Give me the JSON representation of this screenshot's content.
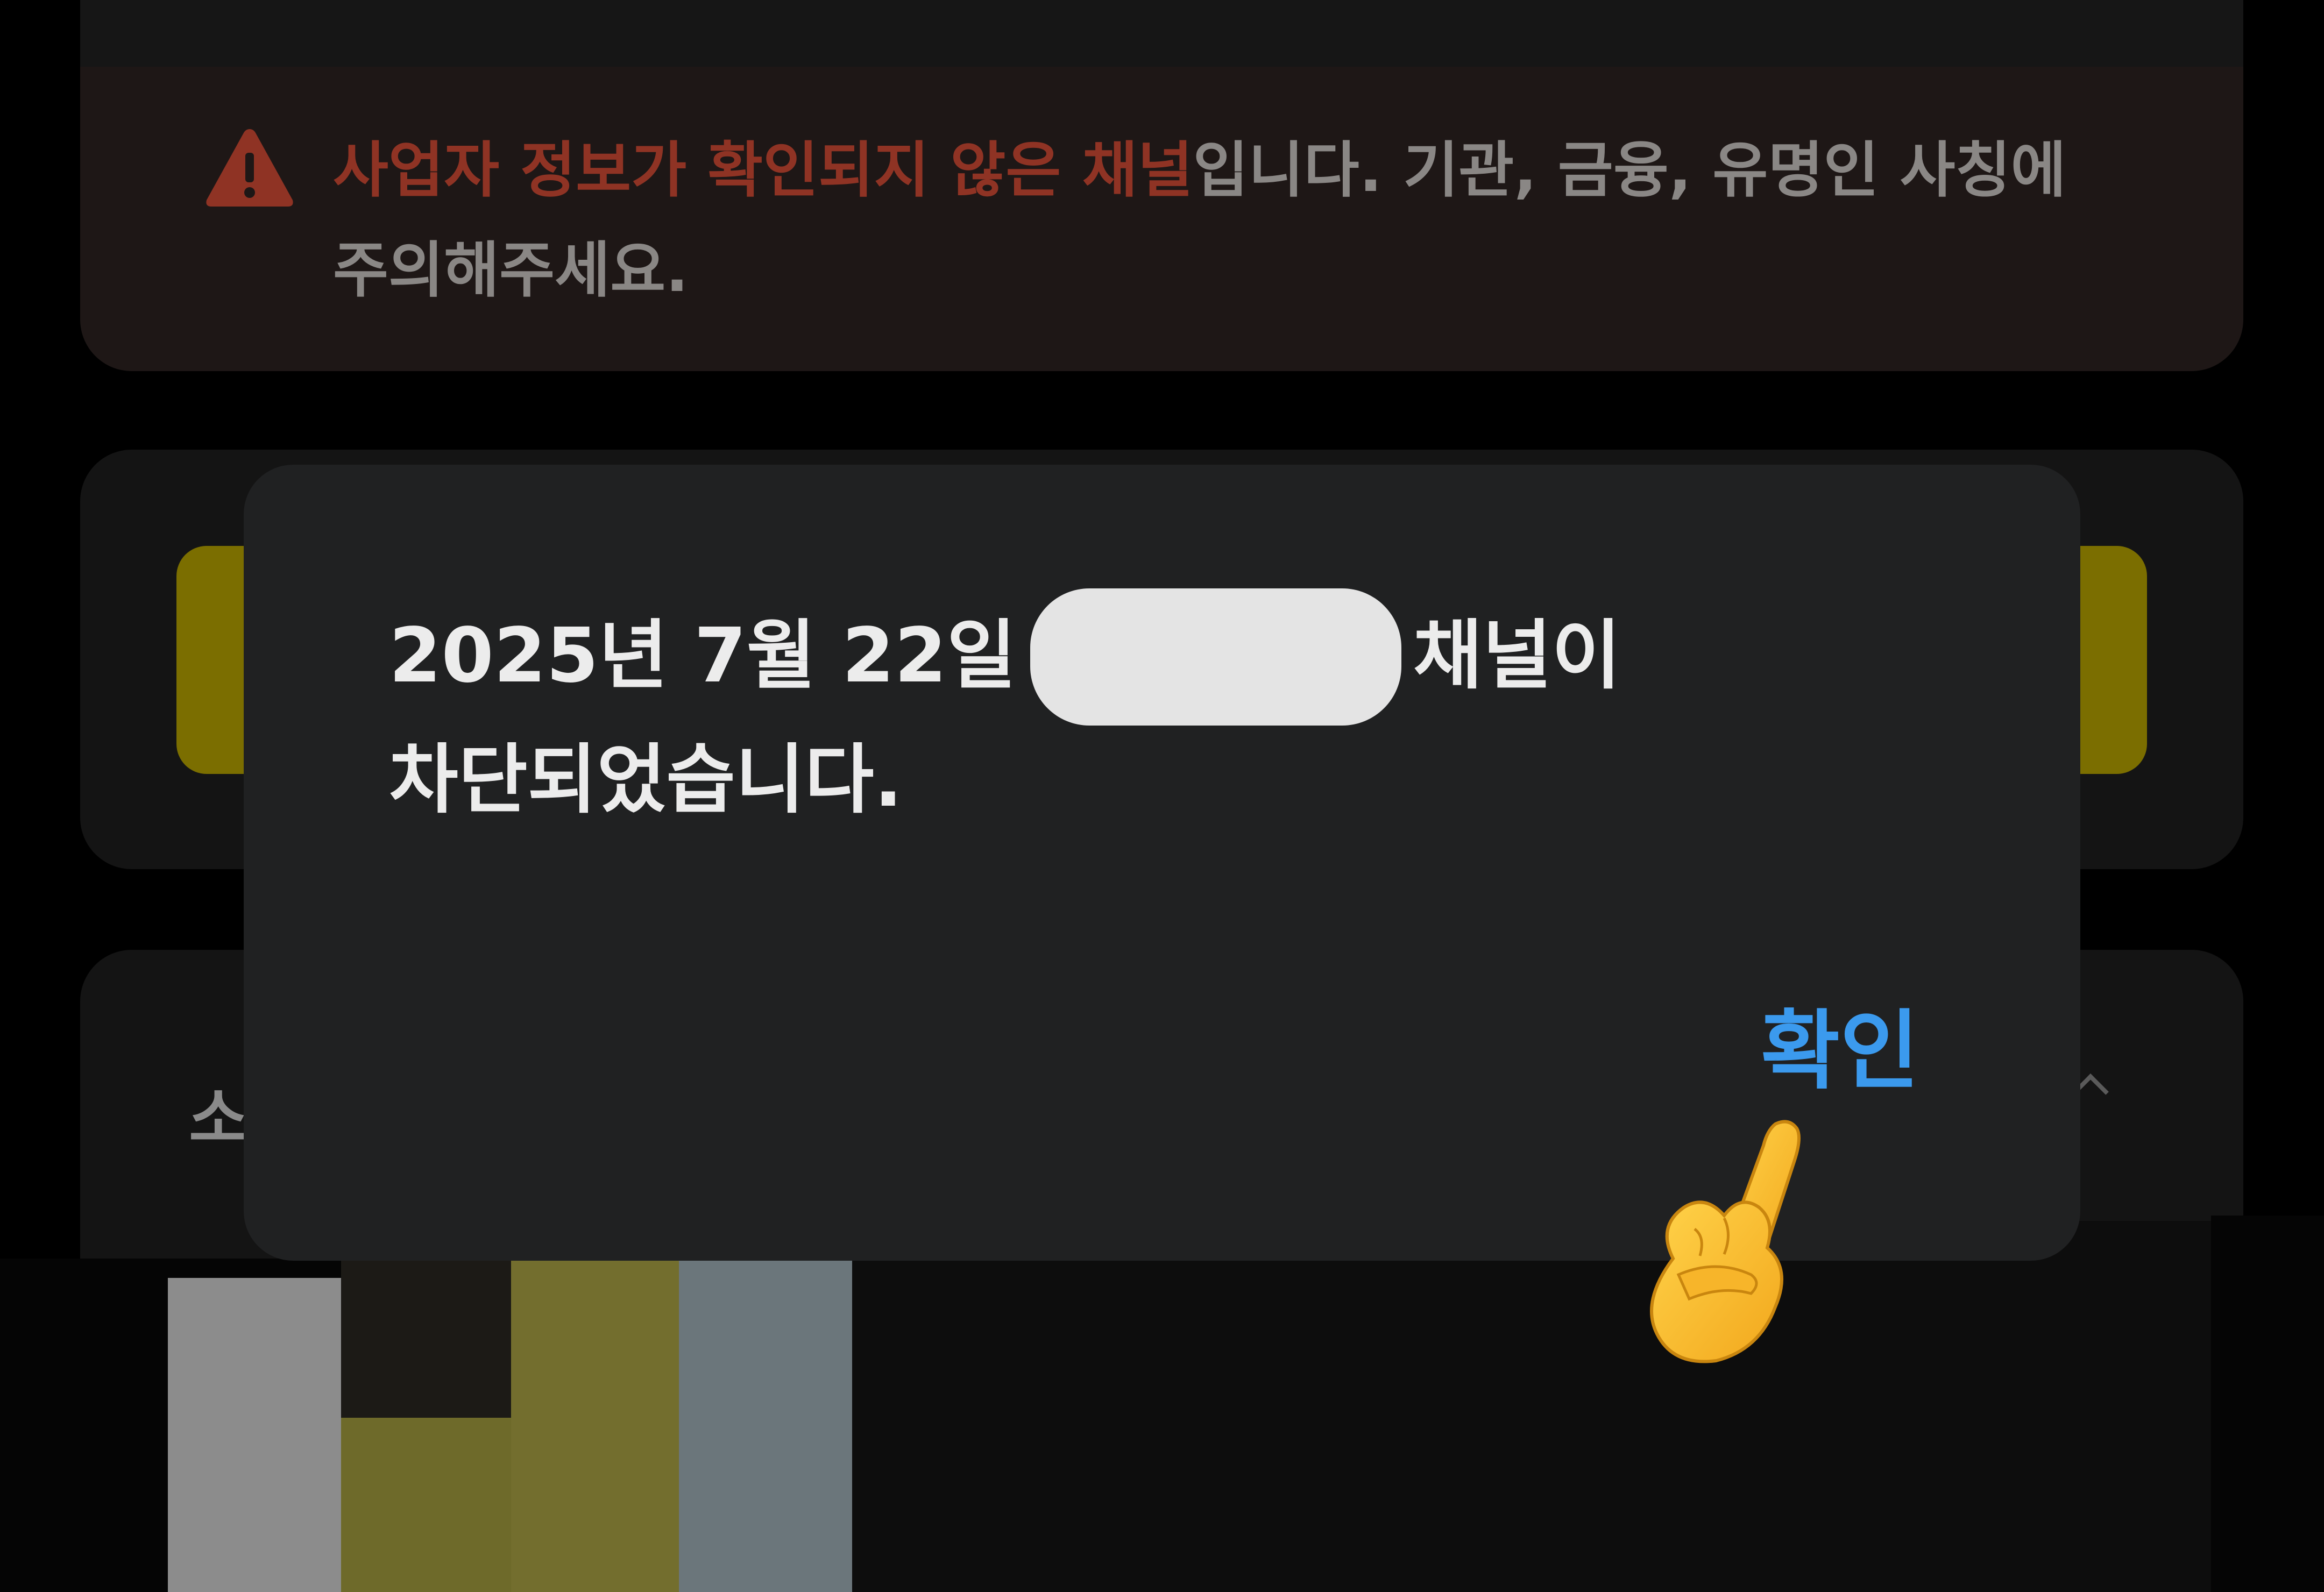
{
  "warning": {
    "icon": "warning-triangle-icon",
    "highlight_text": "사업자 정보가 확인되지 않은 채널",
    "rest_text": "입니다. 기관, 금융, 유명인 사칭에 주의해주세요.",
    "highlight_color": "#8f3324"
  },
  "background_card": {
    "section_letter": "소"
  },
  "dialog": {
    "message_part1": "2025년 7월 22일",
    "message_part2": "채널이",
    "message_line2": "차단되었습니다.",
    "confirm_label": "확인",
    "confirm_color": "#3b9aee"
  },
  "overlay": {
    "hand_icon": "pointing-up-hand-icon"
  }
}
